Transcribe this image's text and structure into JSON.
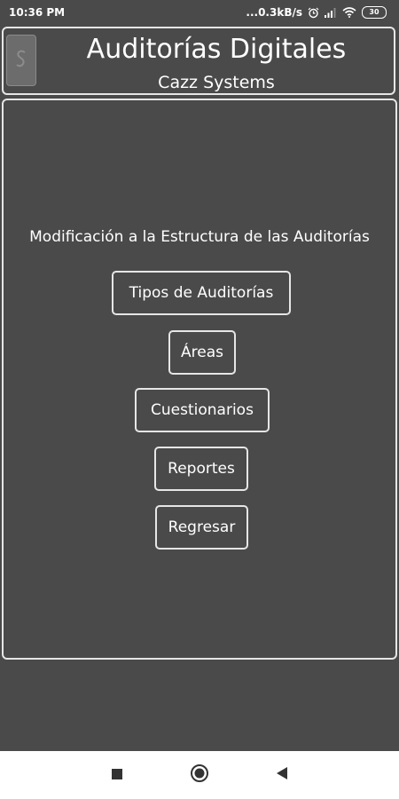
{
  "status_bar": {
    "time": "10:36 PM",
    "network_speed": "...0.3kB/s",
    "battery_level": "30",
    "icons": [
      "alarm-icon",
      "signal-icon",
      "wifi-icon",
      "battery-icon"
    ]
  },
  "header": {
    "title": "Auditorías Digitales",
    "subtitle": "Cazz Systems",
    "menu_icon": "menu-icon"
  },
  "main": {
    "heading": "Modificación a la Estructura de las Auditorías",
    "buttons": [
      {
        "label": "Tipos de Auditorías"
      },
      {
        "label": "Áreas"
      },
      {
        "label": "Cuestionarios"
      },
      {
        "label": "Reportes"
      },
      {
        "label": "Regresar"
      }
    ]
  },
  "nav_bar": {
    "items": [
      "recents-square-icon",
      "home-circle-icon",
      "back-triangle-icon"
    ]
  },
  "colors": {
    "background": "#4a4a4a",
    "border": "#e6e6e6",
    "text": "#ffffff",
    "nav_background": "#ffffff",
    "nav_icons": "#333333"
  }
}
